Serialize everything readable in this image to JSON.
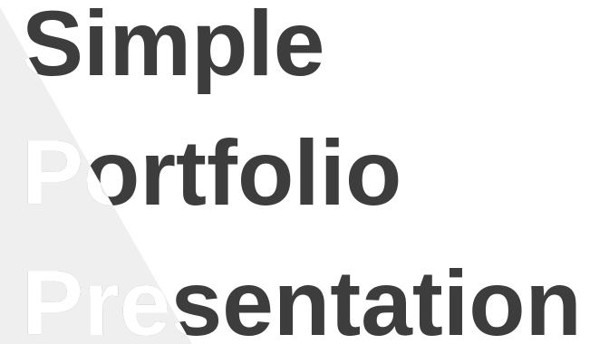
{
  "slide": {
    "title_line_1": "Simple",
    "title_line_2": "Portfolio",
    "title_line_3": "Presentation"
  },
  "colors": {
    "text": "#3d3d3d",
    "triangle": "#efefef",
    "background": "#ffffff"
  }
}
